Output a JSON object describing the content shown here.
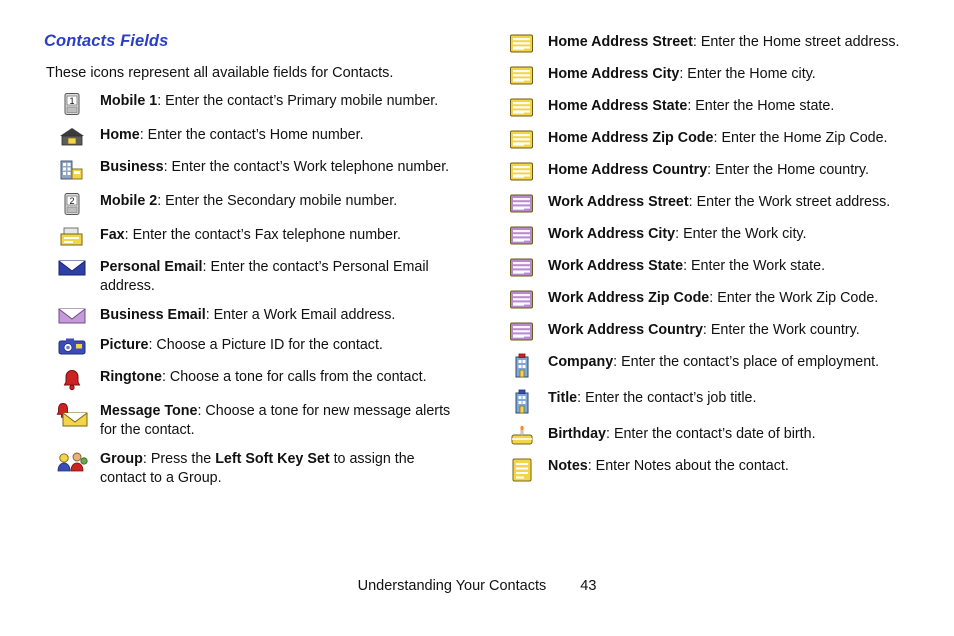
{
  "section": {
    "title": "Contacts Fields",
    "intro": "These icons represent all available fields for Contacts."
  },
  "left_items": [
    {
      "icon": "mobile-1-icon",
      "label": "Mobile 1",
      "desc": ": Enter the contact’s Primary mobile number."
    },
    {
      "icon": "home-phone-icon",
      "label": "Home",
      "desc": ": Enter the contact’s Home number."
    },
    {
      "icon": "business-phone-icon",
      "label": "Business",
      "desc": ": Enter the contact’s Work telephone number."
    },
    {
      "icon": "mobile-2-icon",
      "label": "Mobile 2",
      "desc": ": Enter the Secondary mobile number."
    },
    {
      "icon": "fax-icon",
      "label": "Fax",
      "desc": ": Enter the contact’s Fax telephone number."
    },
    {
      "icon": "personal-email-icon",
      "label": "Personal Email",
      "desc": ": Enter the contact’s  Personal Email address."
    },
    {
      "icon": "business-email-icon",
      "label": "Business Email",
      "desc": ": Enter a Work Email address."
    },
    {
      "icon": "picture-icon",
      "label": "Picture",
      "desc": ": Choose a Picture ID for the contact."
    },
    {
      "icon": "ringtone-icon",
      "label": "Ringtone",
      "desc": ": Choose a tone for calls from the contact."
    },
    {
      "icon": "message-tone-icon",
      "label": "Message Tone",
      "desc": ": Choose a tone for new message alerts for the contact."
    },
    {
      "icon": "group-icon",
      "label": "Group",
      "desc": ": Press the ",
      "desc_bold": "Left Soft Key Set",
      "desc_tail": " to assign the contact to a Group."
    }
  ],
  "right_items": [
    {
      "icon": "home-address-street-icon",
      "label": "Home Address Street",
      "desc": ": Enter the Home street address."
    },
    {
      "icon": "home-address-city-icon",
      "label": "Home Address City",
      "desc": ": Enter the Home city."
    },
    {
      "icon": "home-address-state-icon",
      "label": "Home Address State",
      "desc": ": Enter the Home state."
    },
    {
      "icon": "home-address-zip-icon",
      "label": "Home Address Zip Code",
      "desc": ": Enter the Home Zip Code."
    },
    {
      "icon": "home-address-country-icon",
      "label": "Home Address Country",
      "desc": ": Enter the Home country."
    },
    {
      "icon": "work-address-street-icon",
      "label": "Work Address Street",
      "desc": ": Enter the Work street address."
    },
    {
      "icon": "work-address-city-icon",
      "label": "Work Address City",
      "desc": ": Enter the Work city."
    },
    {
      "icon": "work-address-state-icon",
      "label": "Work Address State",
      "desc": ": Enter the Work state."
    },
    {
      "icon": "work-address-zip-icon",
      "label": "Work Address Zip Code",
      "desc": ": Enter the Work Zip Code."
    },
    {
      "icon": "work-address-country-icon",
      "label": "Work Address Country",
      "desc": ": Enter the Work country."
    },
    {
      "icon": "company-icon",
      "label": "Company",
      "desc": ": Enter the contact’s place of employment."
    },
    {
      "icon": "title-icon",
      "label": "Title",
      "desc": ": Enter the contact’s job title."
    },
    {
      "icon": "birthday-icon",
      "label": "Birthday",
      "desc": ": Enter the contact’s date of birth."
    },
    {
      "icon": "notes-icon",
      "label": "Notes",
      "desc": ": Enter Notes about the contact."
    }
  ],
  "footer": {
    "chapter": "Understanding Your Contacts",
    "page": "43"
  },
  "colors": {
    "heading": "#2b3fc4",
    "yellow": "#f5d84a",
    "purple": "#c49ad8",
    "red": "#cc2222",
    "blue": "#3344aa"
  }
}
